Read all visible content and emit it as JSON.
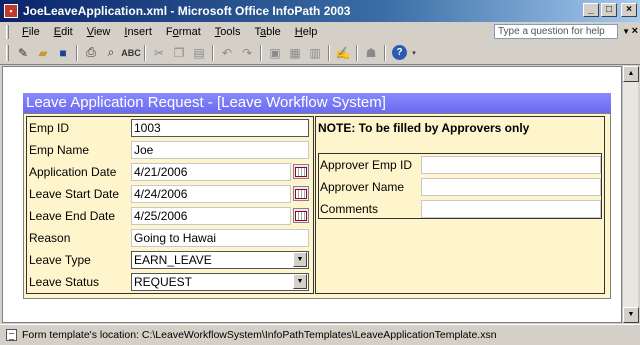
{
  "window": {
    "title": "JoeLeaveApplication.xml - Microsoft Office InfoPath 2003",
    "app_icon": "infopath-icon",
    "controls": {
      "minimize": "_",
      "maximize": "□",
      "close": "×"
    }
  },
  "menubar": {
    "items": [
      {
        "underline": "F",
        "rest": "ile"
      },
      {
        "underline": "E",
        "rest": "dit"
      },
      {
        "underline": "V",
        "rest": "iew"
      },
      {
        "underline": "I",
        "rest": "nsert"
      },
      {
        "underline": "F",
        "rest": "ormat",
        "prefix": "F"
      },
      {
        "underline": "T",
        "rest": "ools"
      },
      {
        "underline": "T",
        "rest": "able",
        "prefix": "Ta"
      },
      {
        "underline": "H",
        "rest": "elp"
      }
    ],
    "help_placeholder": "Type a question for help",
    "close_glyph": "×"
  },
  "toolbar": {
    "buttons": [
      "fill-out-form-icon",
      "open-icon",
      "save-icon",
      "print-icon",
      "print-preview-icon",
      "spelling-icon",
      "cut-icon",
      "copy-icon",
      "paste-icon",
      "undo-icon",
      "redo-icon",
      "insert-picture-icon",
      "insert-table-icon",
      "insert-field-icon",
      "digital-signature-icon",
      "merge-forms-icon",
      "help-icon"
    ]
  },
  "form": {
    "header": "Leave Application Request - [Leave Workflow System]",
    "fields": {
      "emp_id": {
        "label": "Emp ID",
        "value": "1003"
      },
      "emp_name": {
        "label": "Emp Name",
        "value": "Joe"
      },
      "application_date": {
        "label": "Application Date",
        "value": "4/21/2006"
      },
      "leave_start_date": {
        "label": "Leave Start Date",
        "value": "4/24/2006"
      },
      "leave_end_date": {
        "label": "Leave End Date",
        "value": "4/25/2006"
      },
      "reason": {
        "label": "Reason",
        "value": "Going to Hawai"
      },
      "leave_type": {
        "label": "Leave Type",
        "value": "EARN_LEAVE"
      },
      "leave_status": {
        "label": "Leave Status",
        "value": "REQUEST"
      }
    },
    "approver": {
      "note": "NOTE: To be filled by Approvers only",
      "emp_id_label": "Approver Emp ID",
      "name_label": "Approver Name",
      "comments_label": "Comments",
      "emp_id_value": "",
      "name_value": "",
      "comments_value": ""
    },
    "colors": {
      "header_bg": "#7a7af6",
      "body_bg": "#fff5cc"
    }
  },
  "statusbar": {
    "text": "Form template's location: C:\\LeaveWorkflowSystem\\InfoPathTemplates\\LeaveApplicationTemplate.xsn"
  }
}
